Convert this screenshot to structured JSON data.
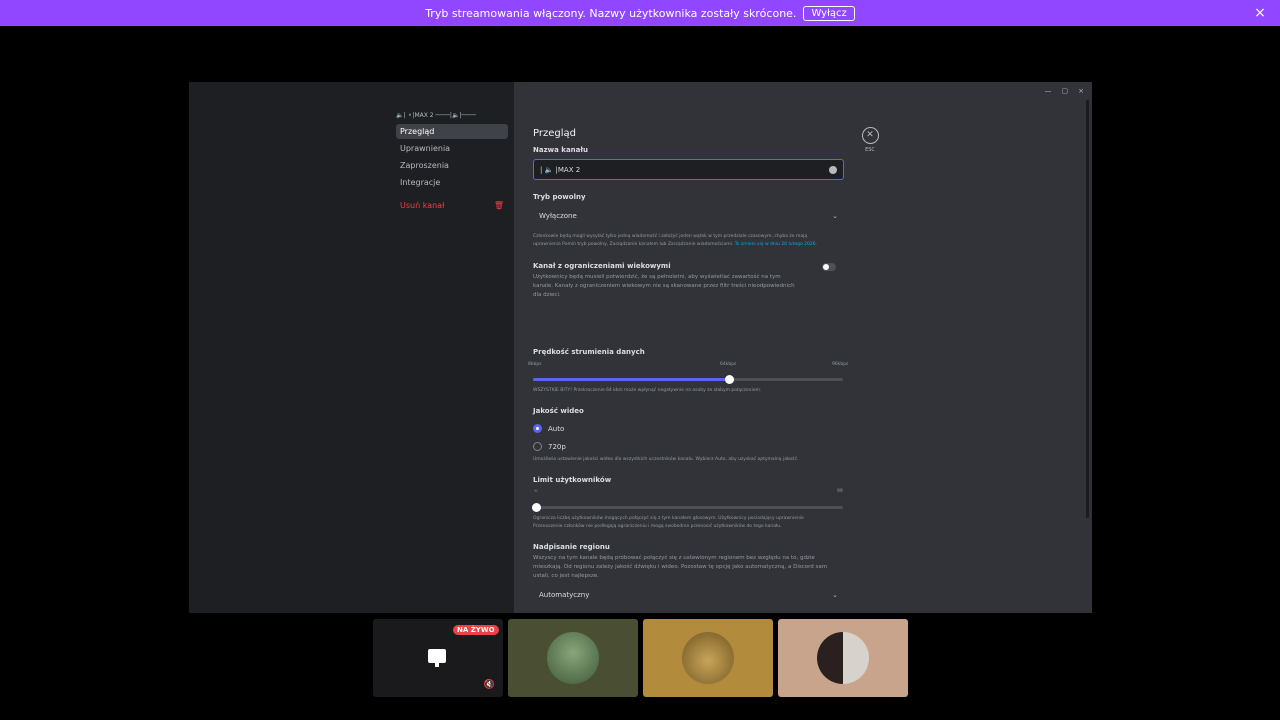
{
  "banner": {
    "message": "Tryb streamowania włączony. Nazwy użytkownika zostały skrócone.",
    "button": "Wyłącz",
    "close_icon": "×"
  },
  "sidebar": {
    "channel_header": "🔈| ⚬|MAX 2 ────|🔈|────",
    "items": [
      {
        "label": "Przegląd",
        "active": true
      },
      {
        "label": "Uprawnienia"
      },
      {
        "label": "Zaproszenia"
      },
      {
        "label": "Integracje"
      }
    ],
    "delete_label": "Usuń kanał",
    "trash_icon": "🗑"
  },
  "window_controls": {
    "minimize": "—",
    "maximize": "▢",
    "close": "×"
  },
  "main": {
    "title": "Przegląd",
    "esc_label": "ESC",
    "esc_icon": "✕",
    "channel_name_label": "Nazwa kanału",
    "channel_name_value": "| 🔈 |MAX 2",
    "slowmode_label": "Tryb powolny",
    "slowmode_value": "Wyłączone",
    "slowmode_help": "Członkowie będą mogli wysyłać tylko jedną wiadomość i założyć jeden wątek w tym przedziale czasowym, chyba że mają uprawnienia Pomiń tryb powolny, Zarządzanie kanałem lub Zarządzanie wiadomościami.",
    "slowmode_link": "To zmieni się w dniu 20 lutego 2026.",
    "age_label": "Kanał z ograniczeniami wiekowymi",
    "age_desc": "Użytkownicy będą musieli potwierdzić, że są pełnoletni, aby wyświetlać zawartość na tym kanale. Kanały z ograniczeniem wiekowym nie są skanowane przez filtr treści nieodpowiednich dla dzieci.",
    "bitrate_label": "Prędkość strumienia danych",
    "bitrate_ticks": [
      "8kbps",
      "64kbps",
      "96kbps"
    ],
    "bitrate_value_kbps": 64,
    "bitrate_help": "WSZYSTKIE BITY! Przekroczenie 64 kb/s może wpłynąć negatywnie na osoby ze słabym połączeniem.",
    "video_label": "Jakość wideo",
    "video_options": [
      "Auto",
      "720p"
    ],
    "video_selected": "Auto",
    "video_help": "Umożliwia ustawienie jakości wideo dla wszystkich uczestników kanału. Wybierz Auto, aby uzyskać optymalną jakość.",
    "limit_label": "Limit użytkowników",
    "limit_ticks": [
      "∞",
      "99"
    ],
    "limit_help": "Ogranicza liczbę użytkowników mogących połączyć się z tym kanałem głosowym. Użytkownicy posiadający uprawnienie Przenoszenie członków nie podlegają ograniczeniu i mogą swobodnie przenosić użytkowników do tego kanału.",
    "region_label": "Nadpisanie regionu",
    "region_desc": "Wszyscy na tym kanale będą próbować połączyć się z ustawionym regionem bez względu na to, gdzie mieszkają. Od regionu zależy jakość dźwięku i wideo. Pozostaw tę opcję jako automatyczną, a Discord sam ustali, co jest najlepsze.",
    "region_value": "Automatyczny",
    "chevron_icon": "⌄"
  },
  "tiles": {
    "live_badge": "NA ŻYWO",
    "mute_icon": "🔇",
    "colors": [
      "#1a1a1c",
      "#4a4f33",
      "#b38b3c",
      "#c8a48c"
    ]
  }
}
